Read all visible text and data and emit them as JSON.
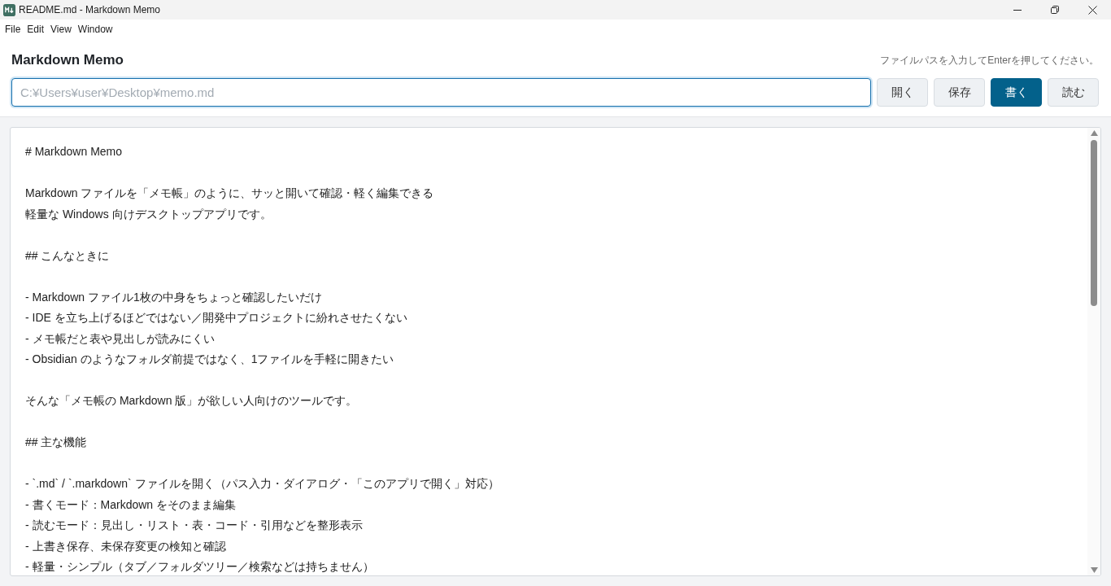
{
  "window": {
    "title": "README.md - Markdown Memo"
  },
  "menu": [
    "File",
    "Edit",
    "View",
    "Window"
  ],
  "header": {
    "title": "Markdown Memo",
    "hint": "ファイルパスを入力してEnterを押してください。"
  },
  "path_field": {
    "placeholder": "C:¥Users¥user¥Desktop¥memo.md",
    "focused": true
  },
  "buttons": [
    {
      "label": "開く",
      "selected": false
    },
    {
      "label": "保存",
      "selected": false
    },
    {
      "label": "書く",
      "selected": true
    },
    {
      "label": "読む",
      "selected": false
    }
  ],
  "editor": {
    "blocks": [
      [
        "# Markdown Memo"
      ],
      [
        "Markdown ファイルを「メモ帳」のように、サッと開いて確認・軽く編集できる",
        "軽量な Windows 向けデスクトップアプリです。"
      ],
      [
        "## こんなときに"
      ],
      [
        "- Markdown ファイル1枚の中身をちょっと確認したいだけ",
        "- IDE を立ち上げるほどではない／開発中プロジェクトに紛れさせたくない",
        "- メモ帳だと表や見出しが読みにくい",
        "- Obsidian のようなフォルダ前提ではなく、1ファイルを手軽に開きたい"
      ],
      [
        "そんな「メモ帳の Markdown 版」が欲しい人向けのツールです。"
      ],
      [
        "## 主な機能"
      ],
      [
        "- `.md` / `.markdown` ファイルを開く（パス入力・ダイアログ・「このアプリで開く」対応）",
        "- 書くモード：Markdown をそのまま編集",
        "- 読むモード：見出し・リスト・表・コード・引用などを整形表示",
        "- 上書き保存、未保存変更の検知と確認",
        "- 軽量・シンプル（タブ／フォルダツリー／検索などは持ちません）"
      ]
    ]
  }
}
